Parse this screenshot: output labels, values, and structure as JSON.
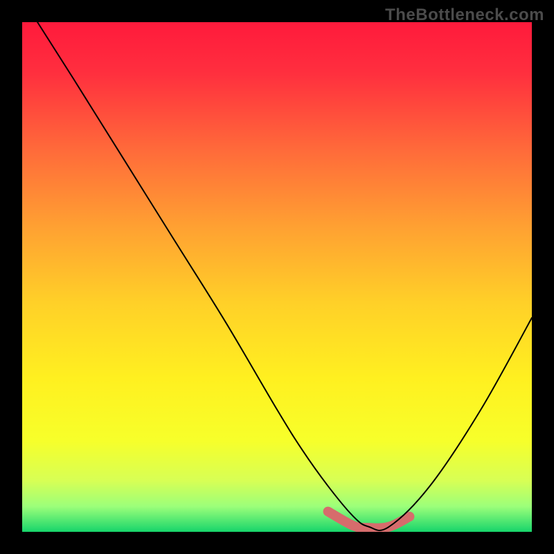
{
  "brand": "TheBottleneck.com",
  "chart_data": {
    "type": "line",
    "title": "",
    "xlabel": "",
    "ylabel": "",
    "xlim": [
      0,
      100
    ],
    "ylim": [
      0,
      100
    ],
    "gradient_stops": [
      {
        "offset": 0.0,
        "color": "#ff1a3c"
      },
      {
        "offset": 0.1,
        "color": "#ff2f3e"
      },
      {
        "offset": 0.25,
        "color": "#ff6a3a"
      },
      {
        "offset": 0.4,
        "color": "#ffa032"
      },
      {
        "offset": 0.55,
        "color": "#ffd028"
      },
      {
        "offset": 0.7,
        "color": "#fff020"
      },
      {
        "offset": 0.82,
        "color": "#f7ff2a"
      },
      {
        "offset": 0.9,
        "color": "#d7ff55"
      },
      {
        "offset": 0.95,
        "color": "#9cff7a"
      },
      {
        "offset": 1.0,
        "color": "#17d56b"
      }
    ],
    "series": [
      {
        "name": "main-curve",
        "x": [
          3,
          10,
          20,
          30,
          40,
          50,
          55,
          60,
          65,
          68,
          72,
          80,
          90,
          100
        ],
        "y": [
          100,
          89,
          73,
          57,
          41,
          24,
          16,
          9,
          3,
          1,
          1,
          9,
          24,
          42
        ]
      },
      {
        "name": "highlight-flat",
        "x": [
          60,
          65,
          68,
          72,
          76
        ],
        "y": [
          4,
          1.2,
          0.8,
          1.0,
          3
        ]
      }
    ]
  }
}
